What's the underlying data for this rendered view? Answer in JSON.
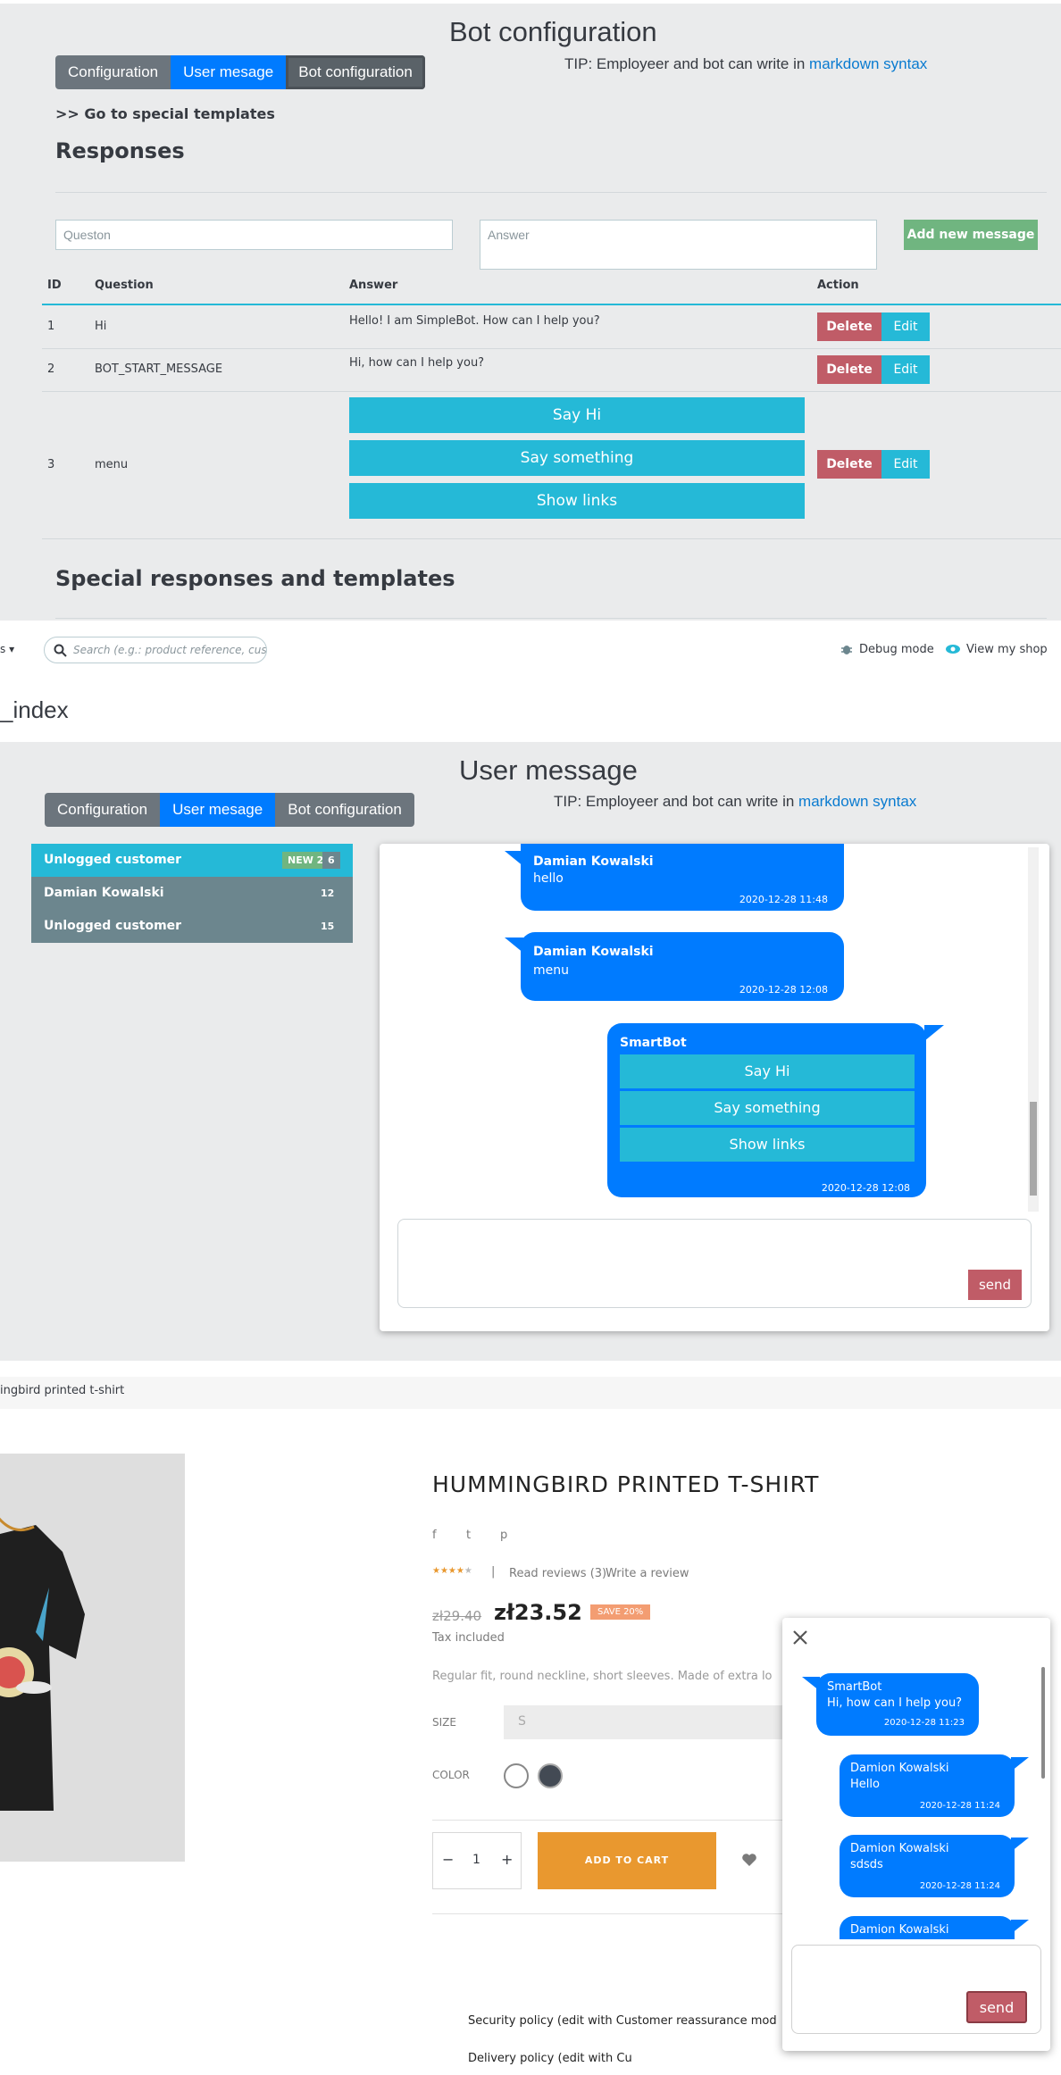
{
  "admin_bot": {
    "page_title": "Bot configuration",
    "tabs": [
      "Configuration",
      "User mesage",
      "Bot configuration"
    ],
    "tip_text": "TIP: Employeer and bot can write in ",
    "tip_link": "markdown syntax",
    "special_link": ">> Go to special templates",
    "responses_heading": "Responses",
    "question_placeholder": "Queston",
    "answer_placeholder": "Answer",
    "add_button": "Add new message",
    "columns": [
      "ID",
      "Question",
      "Answer",
      "Action"
    ],
    "rows": [
      {
        "id": "1",
        "question": "Hi",
        "answer": "Hello! I am SimpleBot. How can I help you?"
      },
      {
        "id": "2",
        "question": "BOT_START_MESSAGE",
        "answer": "Hi, how can I help you?"
      },
      {
        "id": "3",
        "question": "menu",
        "buttons": [
          "Say Hi",
          "Say something",
          "Show links"
        ]
      }
    ],
    "delete_label": "Delete",
    "edit_label": "Edit",
    "special_heading": "Special responses and templates"
  },
  "admin_header": {
    "search_placeholder": "Search (e.g.: product reference, custome",
    "debug_mode": "Debug mode",
    "view_shop": "View my shop",
    "page_fragment": "_index",
    "left_fragment": "s ▾"
  },
  "user_message": {
    "page_title": "User message",
    "tabs": [
      "Configuration",
      "User mesage",
      "Bot configuration"
    ],
    "tip_text": "TIP: Employeer and bot can write in ",
    "tip_link": "markdown syntax",
    "customers": [
      {
        "name": "Unlogged customer",
        "badge_new": "NEW 2",
        "badge_count": "6"
      },
      {
        "name": "Damian Kowalski",
        "badge_count": "12"
      },
      {
        "name": "Unlogged customer",
        "badge_count": "15"
      }
    ],
    "messages": [
      {
        "name": "Damian Kowalski",
        "text": "hello",
        "time": "2020-12-28 11:48"
      },
      {
        "name": "Damian Kowalski",
        "text": "menu",
        "time": "2020-12-28 12:08"
      },
      {
        "name": "SmartBot",
        "buttons": [
          "Say Hi",
          "Say something",
          "Show links"
        ],
        "time": "2020-12-28 12:08"
      }
    ],
    "send_label": "send"
  },
  "shop": {
    "breadcrumb": "ingbird printed t-shirt",
    "product_title": "HUMMINGBIRD PRINTED T-SHIRT",
    "social": [
      "f",
      "t",
      "p"
    ],
    "rating_stars": 4,
    "read_reviews": "Read reviews (3)",
    "write_review": "Write a review",
    "old_price": "zł29.40",
    "price": "zł23.52",
    "discount": "SAVE 20%",
    "tax": "Tax included",
    "description": "Regular fit, round neckline, short sleeves. Made of extra lo",
    "size_label": "SIZE",
    "size_value": "S",
    "color_label": "COLOR",
    "quantity": "1",
    "add_to_cart": "ADD TO CART",
    "security_policy": "Security policy (edit with Customer reassurance mod",
    "delivery_policy": "Delivery policy (edit with Cu"
  },
  "widget": {
    "messages": [
      {
        "name": "SmartBot",
        "text": "Hi, how can I help you?",
        "time": "2020-12-28 11:23"
      },
      {
        "name": "Damion Kowalski",
        "text": "Hello",
        "time": "2020-12-28 11:24"
      },
      {
        "name": "Damion Kowalski",
        "text": "sdsds",
        "time": "2020-12-28 11:24"
      },
      {
        "name": "Damion Kowalski",
        "text": ""
      }
    ],
    "send_label": "send"
  },
  "colors": {
    "primary": "#007bff",
    "info": "#25b9d7",
    "danger": "#c05c67",
    "success": "#70b580",
    "cart": "#e9982f"
  }
}
